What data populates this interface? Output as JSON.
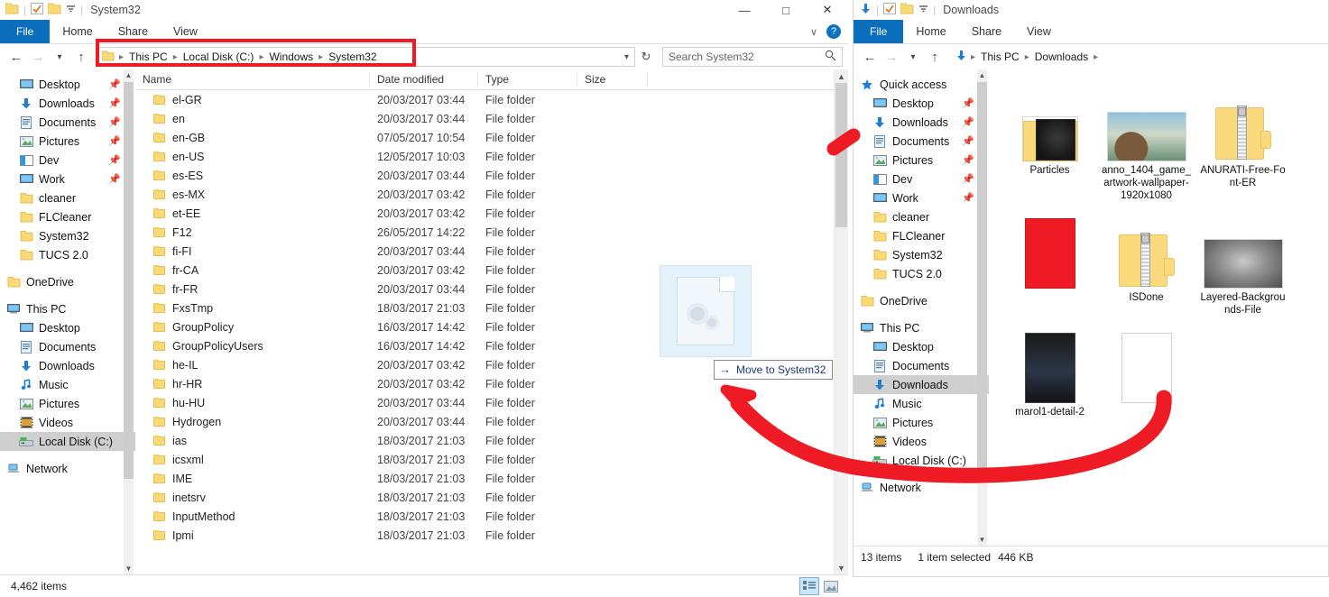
{
  "left_window": {
    "title": "System32",
    "quick_access_icons": [
      "folder-icon",
      "properties-icon",
      "new-folder-icon",
      "dropdown-icon"
    ],
    "window_controls": {
      "minimize": "—",
      "maximize": "□",
      "close": "✕"
    },
    "ribbon_tabs": [
      "File",
      "Home",
      "Share",
      "View"
    ],
    "ribbon_right": {
      "collapse": "∨",
      "help": "?"
    },
    "nav": {
      "back": "←",
      "forward": "→",
      "recent": "∨",
      "up": "↑",
      "refresh": "↻",
      "history": "∨"
    },
    "breadcrumb": [
      "This PC",
      "Local Disk (C:)",
      "Windows",
      "System32"
    ],
    "search": {
      "placeholder": "Search System32",
      "icon": "search-icon"
    },
    "sidebar": [
      {
        "label": "Desktop",
        "icon": "desktop-icon",
        "pinned": true,
        "indent": 1,
        "selected": false
      },
      {
        "label": "Downloads",
        "icon": "downloads-icon",
        "pinned": true,
        "indent": 1,
        "selected": false
      },
      {
        "label": "Documents",
        "icon": "documents-icon",
        "pinned": true,
        "indent": 1,
        "selected": false
      },
      {
        "label": "Pictures",
        "icon": "pictures-icon",
        "pinned": true,
        "indent": 1,
        "selected": false
      },
      {
        "label": "Dev",
        "icon": "dev-icon",
        "pinned": true,
        "indent": 1,
        "selected": false
      },
      {
        "label": "Work",
        "icon": "work-icon",
        "pinned": true,
        "indent": 1,
        "selected": false
      },
      {
        "label": "cleaner",
        "icon": "folder-icon",
        "pinned": false,
        "indent": 1,
        "selected": false
      },
      {
        "label": "FLCleaner",
        "icon": "folder-icon",
        "pinned": false,
        "indent": 1,
        "selected": false
      },
      {
        "label": "System32",
        "icon": "folder-icon",
        "pinned": false,
        "indent": 1,
        "selected": false
      },
      {
        "label": "TUCS 2.0",
        "icon": "folder-icon",
        "pinned": false,
        "indent": 1,
        "selected": false
      },
      {
        "label": "OneDrive",
        "icon": "onedrive-icon",
        "pinned": false,
        "indent": 0,
        "selected": false,
        "gap": true
      },
      {
        "label": "This PC",
        "icon": "thispc-icon",
        "pinned": false,
        "indent": 0,
        "selected": false,
        "gap": true
      },
      {
        "label": "Desktop",
        "icon": "desktop-icon",
        "pinned": false,
        "indent": 1,
        "selected": false
      },
      {
        "label": "Documents",
        "icon": "documents-icon",
        "pinned": false,
        "indent": 1,
        "selected": false
      },
      {
        "label": "Downloads",
        "icon": "downloads-icon",
        "pinned": false,
        "indent": 1,
        "selected": false
      },
      {
        "label": "Music",
        "icon": "music-icon",
        "pinned": false,
        "indent": 1,
        "selected": false
      },
      {
        "label": "Pictures",
        "icon": "pictures-icon",
        "pinned": false,
        "indent": 1,
        "selected": false
      },
      {
        "label": "Videos",
        "icon": "videos-icon",
        "pinned": false,
        "indent": 1,
        "selected": false
      },
      {
        "label": "Local Disk (C:)",
        "icon": "drive-icon",
        "pinned": false,
        "indent": 1,
        "selected": true
      },
      {
        "label": "Network",
        "icon": "network-icon",
        "pinned": false,
        "indent": 0,
        "selected": false,
        "gap": true
      }
    ],
    "columns": [
      "Name",
      "Date modified",
      "Type",
      "Size"
    ],
    "files": [
      {
        "name": "el-GR",
        "date": "20/03/2017 03:44",
        "type": "File folder",
        "size": ""
      },
      {
        "name": "en",
        "date": "20/03/2017 03:44",
        "type": "File folder",
        "size": ""
      },
      {
        "name": "en-GB",
        "date": "07/05/2017 10:54",
        "type": "File folder",
        "size": ""
      },
      {
        "name": "en-US",
        "date": "12/05/2017 10:03",
        "type": "File folder",
        "size": ""
      },
      {
        "name": "es-ES",
        "date": "20/03/2017 03:44",
        "type": "File folder",
        "size": ""
      },
      {
        "name": "es-MX",
        "date": "20/03/2017 03:42",
        "type": "File folder",
        "size": ""
      },
      {
        "name": "et-EE",
        "date": "20/03/2017 03:42",
        "type": "File folder",
        "size": ""
      },
      {
        "name": "F12",
        "date": "26/05/2017 14:22",
        "type": "File folder",
        "size": ""
      },
      {
        "name": "fi-FI",
        "date": "20/03/2017 03:44",
        "type": "File folder",
        "size": ""
      },
      {
        "name": "fr-CA",
        "date": "20/03/2017 03:42",
        "type": "File folder",
        "size": ""
      },
      {
        "name": "fr-FR",
        "date": "20/03/2017 03:44",
        "type": "File folder",
        "size": ""
      },
      {
        "name": "FxsTmp",
        "date": "18/03/2017 21:03",
        "type": "File folder",
        "size": ""
      },
      {
        "name": "GroupPolicy",
        "date": "16/03/2017 14:42",
        "type": "File folder",
        "size": ""
      },
      {
        "name": "GroupPolicyUsers",
        "date": "16/03/2017 14:42",
        "type": "File folder",
        "size": ""
      },
      {
        "name": "he-IL",
        "date": "20/03/2017 03:42",
        "type": "File folder",
        "size": ""
      },
      {
        "name": "hr-HR",
        "date": "20/03/2017 03:42",
        "type": "File folder",
        "size": ""
      },
      {
        "name": "hu-HU",
        "date": "20/03/2017 03:44",
        "type": "File folder",
        "size": ""
      },
      {
        "name": "Hydrogen",
        "date": "20/03/2017 03:44",
        "type": "File folder",
        "size": ""
      },
      {
        "name": "ias",
        "date": "18/03/2017 21:03",
        "type": "File folder",
        "size": ""
      },
      {
        "name": "icsxml",
        "date": "18/03/2017 21:03",
        "type": "File folder",
        "size": ""
      },
      {
        "name": "IME",
        "date": "18/03/2017 21:03",
        "type": "File folder",
        "size": ""
      },
      {
        "name": "inetsrv",
        "date": "18/03/2017 21:03",
        "type": "File folder",
        "size": ""
      },
      {
        "name": "InputMethod",
        "date": "18/03/2017 21:03",
        "type": "File folder",
        "size": ""
      },
      {
        "name": "Ipmi",
        "date": "18/03/2017 21:03",
        "type": "File folder",
        "size": ""
      }
    ],
    "status": {
      "items": "4,462 items"
    },
    "view_buttons": {
      "details": "details-view-icon",
      "large": "large-icons-view-icon"
    }
  },
  "drag": {
    "ghost_icon": "settings-document-icon",
    "tooltip_label": "Move to System32",
    "tooltip_arrow": "→"
  },
  "right_window": {
    "title": "Downloads",
    "quick_access_icons": [
      "downloads-icon",
      "properties-icon",
      "new-folder-icon",
      "dropdown-icon"
    ],
    "ribbon_tabs": [
      "File",
      "Home",
      "Share",
      "View"
    ],
    "nav": {
      "back": "←",
      "forward": "→",
      "recent": "∨",
      "up": "↑"
    },
    "breadcrumb": [
      "This PC",
      "Downloads"
    ],
    "sidebar": [
      {
        "label": "Quick access",
        "icon": "star-icon",
        "pinned": false,
        "indent": 0,
        "selected": false
      },
      {
        "label": "Desktop",
        "icon": "desktop-icon",
        "pinned": true,
        "indent": 1,
        "selected": false
      },
      {
        "label": "Downloads",
        "icon": "downloads-icon",
        "pinned": true,
        "indent": 1,
        "selected": false
      },
      {
        "label": "Documents",
        "icon": "documents-icon",
        "pinned": true,
        "indent": 1,
        "selected": false
      },
      {
        "label": "Pictures",
        "icon": "pictures-icon",
        "pinned": true,
        "indent": 1,
        "selected": false
      },
      {
        "label": "Dev",
        "icon": "dev-icon",
        "pinned": true,
        "indent": 1,
        "selected": false
      },
      {
        "label": "Work",
        "icon": "work-icon",
        "pinned": true,
        "indent": 1,
        "selected": false
      },
      {
        "label": "cleaner",
        "icon": "folder-icon",
        "pinned": false,
        "indent": 1,
        "selected": false
      },
      {
        "label": "FLCleaner",
        "icon": "folder-icon",
        "pinned": false,
        "indent": 1,
        "selected": false
      },
      {
        "label": "System32",
        "icon": "folder-icon",
        "pinned": false,
        "indent": 1,
        "selected": false
      },
      {
        "label": "TUCS 2.0",
        "icon": "folder-icon",
        "pinned": false,
        "indent": 1,
        "selected": false
      },
      {
        "label": "OneDrive",
        "icon": "onedrive-icon",
        "pinned": false,
        "indent": 0,
        "selected": false,
        "gap": true
      },
      {
        "label": "This PC",
        "icon": "thispc-icon",
        "pinned": false,
        "indent": 0,
        "selected": false,
        "gap": true
      },
      {
        "label": "Desktop",
        "icon": "desktop-icon",
        "pinned": false,
        "indent": 1,
        "selected": false
      },
      {
        "label": "Documents",
        "icon": "documents-icon",
        "pinned": false,
        "indent": 1,
        "selected": false
      },
      {
        "label": "Downloads",
        "icon": "downloads-icon",
        "pinned": false,
        "indent": 1,
        "selected": true
      },
      {
        "label": "Music",
        "icon": "music-icon",
        "pinned": false,
        "indent": 1,
        "selected": false
      },
      {
        "label": "Pictures",
        "icon": "pictures-icon",
        "pinned": false,
        "indent": 1,
        "selected": false
      },
      {
        "label": "Videos",
        "icon": "videos-icon",
        "pinned": false,
        "indent": 1,
        "selected": false
      },
      {
        "label": "Local Disk (C:)",
        "icon": "drive-icon",
        "pinned": false,
        "indent": 1,
        "selected": false
      },
      {
        "label": "Network",
        "icon": "network-icon",
        "pinned": false,
        "indent": 0,
        "selected": false,
        "gap": true
      }
    ],
    "items": [
      {
        "label": "Particles",
        "kind": "folder-preview"
      },
      {
        "label": "anno_1404_game_artwork-wallpaper-1920x1080",
        "kind": "photo-anno"
      },
      {
        "label": "ANURATI-Free-Font-ER",
        "kind": "zip-folder"
      },
      {
        "label": "",
        "kind": "photo-red"
      },
      {
        "label": "ISDone",
        "kind": "zip-folder"
      },
      {
        "label": "Layered-Backgrounds-File",
        "kind": "photo-layered"
      },
      {
        "label": "marol1-detail-2",
        "kind": "photo-dark"
      },
      {
        "label": "",
        "kind": "photo-blank"
      }
    ],
    "status": {
      "items": "13 items",
      "selected": "1 item selected",
      "size": "446 KB"
    }
  },
  "annotations": {
    "address_highlight_color": "#ee1b24",
    "arrow_color": "#ee1b24"
  }
}
